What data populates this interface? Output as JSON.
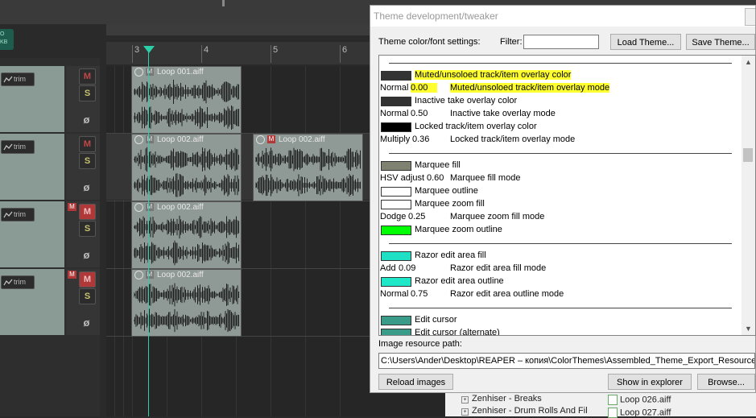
{
  "arrange": {
    "badge_lines": [
      "O",
      "KB"
    ],
    "ruler_marks": [
      "3",
      "4",
      "5",
      "6"
    ],
    "tracks": [
      {
        "trim": "trim",
        "mute": "M",
        "solo": "S",
        "phase": "ø",
        "muted": false,
        "item_muted": false
      },
      {
        "trim": "trim",
        "mute": "M",
        "solo": "S",
        "phase": "ø",
        "muted": false,
        "item_muted": false
      },
      {
        "trim": "trim",
        "mute": "M",
        "solo": "S",
        "phase": "ø",
        "muted": true,
        "small_m": "M"
      },
      {
        "trim": "trim",
        "mute": "M",
        "solo": "S",
        "phase": "ø",
        "muted": true,
        "small_m": "M"
      }
    ],
    "items": [
      {
        "name": "Loop 001.aiff",
        "m": "M",
        "muted": false
      },
      {
        "name": "Loop 002.aiff",
        "m": "M",
        "muted": false
      },
      {
        "name": "Loop 002.aiff",
        "m": "M",
        "muted": true
      },
      {
        "name": "Loop 002.aiff",
        "m": "M",
        "muted": false
      },
      {
        "name": "Loop 002.aiff",
        "m": "M",
        "muted": false
      }
    ]
  },
  "explorer": {
    "left_rows": [
      "Zenhiser - Breaks",
      "Zenhiser - Drum Rolls And Fil"
    ],
    "right_rows": [
      "Loop 026.aiff",
      "Loop 027.aiff"
    ]
  },
  "dialog": {
    "title": "Theme development/tweaker",
    "settings_label": "Theme color/font settings:",
    "filter_label": "Filter:",
    "filter_value": "",
    "load_button": "Load Theme...",
    "save_button": "Save Theme...",
    "list": [
      {
        "kind": "sep"
      },
      {
        "kind": "color",
        "swatch": "#333333",
        "label": "Muted/unsoloed track/item overlay color",
        "highlight": true
      },
      {
        "kind": "mode",
        "mode": "Normal",
        "value": "0.00",
        "label": "Muted/unsoloed track/item overlay mode",
        "highlight": true
      },
      {
        "kind": "color",
        "swatch": "#333333",
        "label": "Inactive take overlay color"
      },
      {
        "kind": "mode",
        "mode": "Normal",
        "value": "0.50",
        "label": "Inactive take overlay mode"
      },
      {
        "kind": "color",
        "swatch": "#000000",
        "label": "Locked track/item overlay color"
      },
      {
        "kind": "mode",
        "mode": "Multiply",
        "value": "0.36",
        "label": "Locked track/item overlay mode"
      },
      {
        "kind": "sep"
      },
      {
        "kind": "color",
        "swatch": "#7f8270",
        "label": "Marquee fill"
      },
      {
        "kind": "mode",
        "mode": "HSV adjust",
        "value": "0.60",
        "label": "Marquee fill mode"
      },
      {
        "kind": "color",
        "swatch": "#ffffff",
        "label": "Marquee outline"
      },
      {
        "kind": "color",
        "swatch": "#ffffff",
        "label": "Marquee zoom fill"
      },
      {
        "kind": "mode",
        "mode": "Dodge",
        "value": "0.25",
        "label": "Marquee zoom fill mode"
      },
      {
        "kind": "color",
        "swatch": "#00ff00",
        "label": "Marquee zoom outline"
      },
      {
        "kind": "sep"
      },
      {
        "kind": "color",
        "swatch": "#1fe0c4",
        "label": "Razor edit area fill"
      },
      {
        "kind": "mode",
        "mode": "Add",
        "value": "0.09",
        "label": "Razor edit area fill mode"
      },
      {
        "kind": "color",
        "swatch": "#1fe8c8",
        "label": "Razor edit area outline"
      },
      {
        "kind": "mode",
        "mode": "Normal",
        "value": "0.75",
        "label": "Razor edit area outline mode"
      },
      {
        "kind": "sep"
      },
      {
        "kind": "color",
        "swatch": "#3a9c88",
        "label": "Edit cursor"
      },
      {
        "kind": "color",
        "swatch": "#3a9c88",
        "label": "Edit cursor (alternate)"
      }
    ],
    "path_label": "Image resource path:",
    "path_value": "C:\\Users\\Ander\\Desktop\\REAPER – копия\\ColorThemes\\Assembled_Theme_Export_Resources",
    "reload_button": "Reload images",
    "show_button": "Show in explorer",
    "browse_button": "Browse..."
  }
}
